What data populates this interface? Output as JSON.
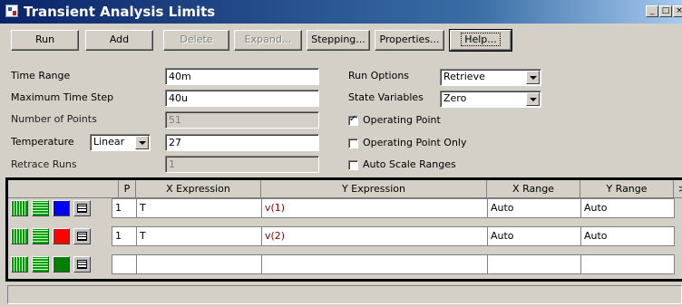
{
  "window": {
    "title": "Transient Analysis Limits",
    "controls": {
      "minimize": "_",
      "maximize": "□",
      "close": "×"
    }
  },
  "toolbar": {
    "run": "Run",
    "add": "Add",
    "delete": "Delete",
    "expand": "Expand...",
    "stepping": "Stepping...",
    "properties": "Properties...",
    "help": "Help..."
  },
  "limits": {
    "time_range_label": "Time Range",
    "time_range": "40m",
    "max_time_step_label": "Maximum Time Step",
    "max_time_step": "40u",
    "num_points_label": "Number of Points",
    "num_points": "51",
    "temperature_label": "Temperature",
    "temperature_mode": "Linear",
    "temperature": "27",
    "retrace_runs_label": "Retrace Runs",
    "retrace_runs": "1"
  },
  "options": {
    "run_options_label": "Run Options",
    "run_options": "Retrieve",
    "state_variables_label": "State Variables",
    "state_variables": "Zero",
    "operating_point": "Operating Point",
    "operating_point_checked": true,
    "operating_point_only": "Operating Point Only",
    "operating_point_only_checked": false,
    "auto_scale": "Auto Scale Ranges",
    "auto_scale_checked": false
  },
  "grid": {
    "headers": {
      "p": "P",
      "x": "X Expression",
      "y": "Y Expression",
      "xr": "X Range",
      "yr": "Y Range",
      "more": ">"
    },
    "rows": [
      {
        "color": "#0000ff",
        "p": "1",
        "x": "T",
        "y": "v(1)",
        "xr": "Auto",
        "yr": "Auto"
      },
      {
        "color": "#ff0000",
        "p": "1",
        "x": "T",
        "y": "v(2)",
        "xr": "Auto",
        "yr": "Auto"
      },
      {
        "color": "#008000",
        "p": "",
        "x": "",
        "y": "",
        "xr": "",
        "yr": ""
      }
    ]
  }
}
